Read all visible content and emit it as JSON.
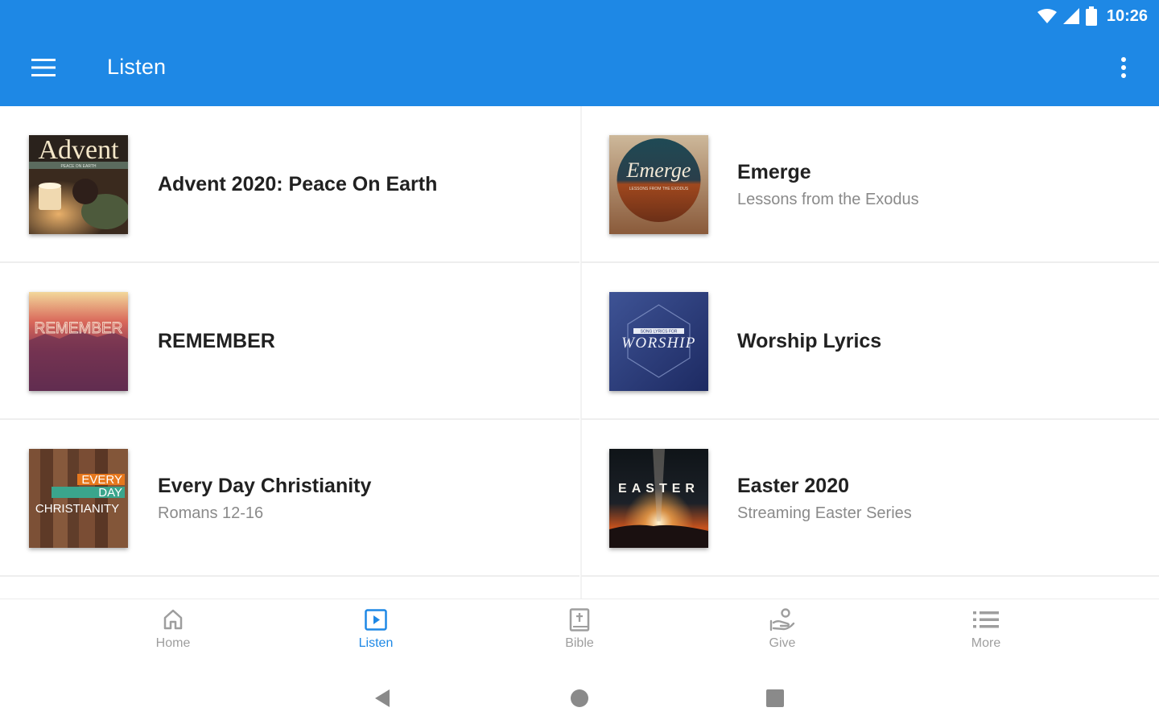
{
  "status_bar": {
    "time": "10:26"
  },
  "app_bar": {
    "title": "Listen"
  },
  "series": [
    {
      "title": "Advent 2020: Peace On Earth",
      "subtitle": "",
      "art_text": "Advent",
      "art_subtext": "PEACE ON EARTH"
    },
    {
      "title": "Emerge",
      "subtitle": "Lessons from the Exodus",
      "art_text": "Emerge",
      "art_subtext": "LESSONS FROM THE EXODUS"
    },
    {
      "title": "REMEMBER",
      "subtitle": "",
      "art_text": "REMEMBER",
      "art_subtext": ""
    },
    {
      "title": "Worship Lyrics",
      "subtitle": "",
      "art_text": "WORSHIP",
      "art_subtext": "SONG LYRICS FOR"
    },
    {
      "title": "Every Day Christianity",
      "subtitle": "Romans 12-16",
      "art_text": "EVERY",
      "art_text2": "DAY",
      "art_text3": "CHRISTIANITY"
    },
    {
      "title": "Easter 2020",
      "subtitle": "Streaming Easter Series",
      "art_text": "EASTER",
      "art_subtext": ""
    }
  ],
  "bottom_nav": {
    "items": [
      {
        "label": "Home",
        "icon": "home-icon",
        "active": false
      },
      {
        "label": "Listen",
        "icon": "play-box-icon",
        "active": true
      },
      {
        "label": "Bible",
        "icon": "bible-icon",
        "active": false
      },
      {
        "label": "Give",
        "icon": "give-icon",
        "active": false
      },
      {
        "label": "More",
        "icon": "list-icon",
        "active": false
      }
    ]
  },
  "colors": {
    "primary": "#1e88e5",
    "nav_inactive": "#9e9e9e",
    "title_text": "#212121",
    "subtitle_text": "#8a8a8a"
  }
}
